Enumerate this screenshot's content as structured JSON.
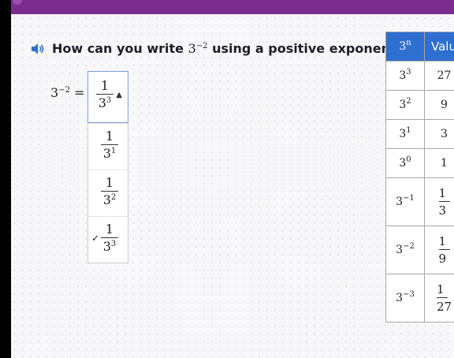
{
  "header": {
    "accent_color": "#7b2d8e"
  },
  "question": {
    "speaker_icon": "speaker-icon",
    "prefix": "How can you write ",
    "base": "3",
    "exp": "−2",
    "suffix": " using a positive exponent?"
  },
  "expression": {
    "base": "3",
    "exp": "−2",
    "equals": "="
  },
  "dropdown": {
    "selected": {
      "num": "1",
      "base": "3",
      "exp": "3"
    },
    "caret": "▲",
    "options": [
      {
        "num": "1",
        "base": "3",
        "exp": "1",
        "checked": false
      },
      {
        "num": "1",
        "base": "3",
        "exp": "2",
        "checked": false
      },
      {
        "num": "1",
        "base": "3",
        "exp": "3",
        "checked": true
      }
    ],
    "check_mark": "✓"
  },
  "table": {
    "header": {
      "power_base": "3",
      "power_exp": "n",
      "value": "Valu"
    },
    "rows": [
      {
        "base": "3",
        "exp": "3",
        "value": "27"
      },
      {
        "base": "3",
        "exp": "2",
        "value": "9"
      },
      {
        "base": "3",
        "exp": "1",
        "value": "3"
      },
      {
        "base": "3",
        "exp": "0",
        "value": "1"
      },
      {
        "base": "3",
        "exp": "−1",
        "num": "1",
        "den": "3"
      },
      {
        "base": "3",
        "exp": "−2",
        "num": "1",
        "den": "9"
      },
      {
        "base": "3",
        "exp": "−3",
        "num": "1",
        "den": "27"
      }
    ]
  }
}
